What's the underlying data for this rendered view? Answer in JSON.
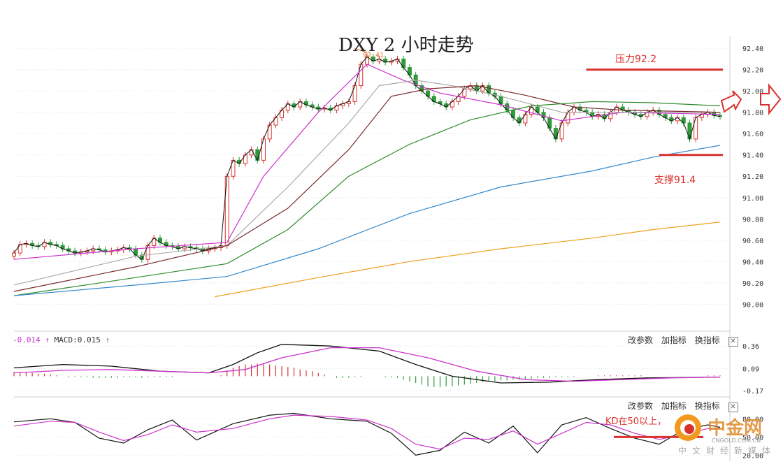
{
  "title": "DXY 2 小时走势",
  "colors": {
    "up": "#d9322e",
    "down": "#2e9a3a",
    "ma_black": "#111111",
    "ma_violet": "#cc33cc",
    "ma_gray": "#aaaaaa",
    "ma_maroon": "#7a2a2a",
    "ma_green": "#2e8b2e",
    "ma_blue": "#3388cc",
    "ma_orange": "#f0a020",
    "annot_red": "#d9322e",
    "grid": "#e6e6e6"
  },
  "toolbar": {
    "params": "改参数",
    "add": "加指标",
    "switch": "换指标",
    "close": "✕"
  },
  "macd_label": {
    "value": "-0.014",
    "arrow": "↑",
    "text": "MACD:0.015",
    "arrow2": "↑"
  },
  "annotations": {
    "resistance": "压力92.2",
    "support": "支撑91.4",
    "kd_note": "KD在50以上，",
    "high_label": "92.41"
  },
  "watermark": {
    "brand": "中金网",
    "domain": "CNGOLD.COM.CN",
    "tagline": "中文财经新媒体",
    "icon": "flame-logo-icon"
  },
  "chart_data": [
    {
      "type": "candlestick",
      "title": "DXY 2 小时走势",
      "y_ticks": [
        "92.40",
        "92.20",
        "92.00",
        "91.80",
        "91.60",
        "91.40",
        "91.20",
        "91.00",
        "90.80",
        "90.60",
        "90.40",
        "90.20",
        "90.00"
      ],
      "ylim": [
        89.93,
        92.46
      ],
      "closes": [
        90.48,
        90.56,
        90.57,
        90.55,
        90.54,
        90.58,
        90.56,
        90.55,
        90.52,
        90.5,
        90.48,
        90.49,
        90.5,
        90.52,
        90.51,
        90.49,
        90.5,
        90.51,
        90.53,
        90.52,
        90.46,
        90.42,
        90.55,
        90.62,
        90.58,
        90.55,
        90.54,
        90.52,
        90.54,
        90.53,
        90.52,
        90.5,
        90.52,
        90.53,
        90.55,
        91.2,
        91.35,
        91.32,
        91.4,
        91.45,
        91.35,
        91.55,
        91.68,
        91.75,
        91.82,
        91.88,
        91.85,
        91.9,
        91.87,
        91.85,
        91.83,
        91.84,
        91.82,
        91.86,
        91.88,
        91.9,
        92.05,
        92.25,
        92.32,
        92.28,
        92.3,
        92.27,
        92.28,
        92.3,
        92.22,
        92.15,
        92.05,
        92.0,
        91.95,
        91.9,
        91.88,
        91.85,
        91.9,
        91.95,
        92.02,
        92.05,
        92.0,
        92.05,
        91.98,
        91.95,
        91.88,
        91.82,
        91.75,
        91.7,
        91.78,
        91.85,
        91.8,
        91.75,
        91.65,
        91.55,
        91.7,
        91.8,
        91.85,
        91.82,
        91.8,
        91.76,
        91.78,
        91.74,
        91.8,
        91.85,
        91.82,
        91.8,
        91.78,
        91.76,
        91.8,
        91.82,
        91.78,
        91.75,
        91.72,
        91.75,
        91.7,
        91.55,
        91.75,
        91.78,
        91.8,
        91.77,
        91.76
      ],
      "ma_lines": [
        {
          "color_key": "ma_violet",
          "x": [
            0,
            20,
            35,
            41,
            50,
            58,
            64,
            70,
            80,
            90,
            100,
            116
          ],
          "y": [
            90.42,
            90.52,
            90.58,
            91.2,
            91.8,
            92.25,
            92.1,
            91.98,
            91.87,
            91.72,
            91.8,
            91.78
          ]
        },
        {
          "color_key": "ma_gray",
          "x": [
            0,
            20,
            35,
            45,
            55,
            60,
            66,
            72,
            80,
            90,
            100,
            116
          ],
          "y": [
            90.18,
            90.45,
            90.55,
            91.1,
            91.7,
            92.05,
            92.1,
            92.05,
            91.95,
            91.8,
            91.8,
            91.8
          ]
        },
        {
          "color_key": "ma_maroon",
          "x": [
            0,
            20,
            35,
            45,
            55,
            62,
            68,
            76,
            84,
            92,
            100,
            116
          ],
          "y": [
            90.12,
            90.35,
            90.55,
            90.9,
            91.45,
            91.95,
            92.02,
            92.05,
            91.96,
            91.85,
            91.82,
            91.8
          ]
        },
        {
          "color_key": "ma_green",
          "x": [
            0,
            20,
            35,
            45,
            55,
            65,
            75,
            85,
            95,
            105,
            116
          ],
          "y": [
            90.08,
            90.25,
            90.38,
            90.7,
            91.2,
            91.5,
            91.73,
            91.86,
            91.9,
            91.89,
            91.86
          ]
        },
        {
          "color_key": "ma_blue",
          "x": [
            0,
            20,
            35,
            50,
            65,
            80,
            95,
            105,
            116
          ],
          "y": [
            90.08,
            90.18,
            90.26,
            90.52,
            90.85,
            91.1,
            91.25,
            91.38,
            91.49
          ]
        },
        {
          "color_key": "ma_orange",
          "x": [
            33,
            50,
            65,
            80,
            95,
            105,
            116
          ],
          "y": [
            90.07,
            90.25,
            90.4,
            90.52,
            90.62,
            90.7,
            90.77
          ]
        }
      ],
      "levels": [
        {
          "label": "压力92.2",
          "value": 92.2,
          "x_from": 94,
          "x_to": 116
        },
        {
          "label": "支撑91.4",
          "value": 91.4,
          "x_from": 106,
          "x_to": 116
        }
      ]
    },
    {
      "type": "macd",
      "y_ticks": [
        "0.36",
        "0.09",
        "-0.17"
      ],
      "ylim": [
        -0.23,
        0.42
      ],
      "hist": [
        0.05,
        0.05,
        0.04,
        0.04,
        0.03,
        0.03,
        0.02,
        0.01,
        0.0,
        -0.01,
        -0.01,
        -0.01,
        -0.01,
        -0.02,
        -0.02,
        -0.02,
        -0.02,
        -0.02,
        -0.01,
        -0.01,
        -0.01,
        -0.02,
        -0.01,
        -0.01,
        -0.01,
        -0.01,
        -0.01,
        0.0,
        0.0,
        0.0,
        0.0,
        0.0,
        0.0,
        0.0,
        0.01,
        0.07,
        0.1,
        0.12,
        0.14,
        0.14,
        0.15,
        0.15,
        0.14,
        0.13,
        0.12,
        0.11,
        0.1,
        0.08,
        0.07,
        0.06,
        0.04,
        0.02,
        0.0,
        -0.02,
        -0.02,
        -0.02,
        -0.01,
        -0.01,
        0.0,
        0.0,
        0.0,
        -0.01,
        -0.01,
        -0.02,
        -0.04,
        -0.06,
        -0.08,
        -0.1,
        -0.12,
        -0.13,
        -0.13,
        -0.12,
        -0.12,
        -0.11,
        -0.1,
        -0.09,
        -0.08,
        -0.07,
        -0.06,
        -0.06,
        -0.05,
        -0.05,
        -0.04,
        -0.04,
        -0.03,
        -0.03,
        -0.02,
        -0.02,
        -0.02,
        -0.01,
        -0.01,
        -0.01,
        -0.01,
        0.0,
        0.0,
        0.0,
        0.01,
        0.01,
        0.01,
        0.01,
        0.01,
        0.01,
        0.01,
        0.01,
        0.0,
        0.0,
        0.0,
        0.0,
        0.0,
        0.0,
        0.0,
        0.0,
        0.0,
        0.0,
        0.01,
        0.01,
        0.01
      ],
      "lines": [
        {
          "color_key": "ma_black",
          "x": [
            0,
            8,
            16,
            24,
            32,
            36,
            40,
            44,
            52,
            60,
            66,
            72,
            80,
            88,
            96,
            104,
            116
          ],
          "y": [
            0.1,
            0.14,
            0.12,
            0.06,
            0.04,
            0.14,
            0.28,
            0.38,
            0.36,
            0.3,
            0.14,
            0.0,
            -0.08,
            -0.07,
            -0.04,
            -0.02,
            -0.01
          ]
        },
        {
          "color_key": "ma_violet",
          "x": [
            0,
            8,
            16,
            24,
            32,
            38,
            44,
            52,
            60,
            68,
            76,
            84,
            92,
            100,
            108,
            116
          ],
          "y": [
            0.04,
            0.07,
            0.08,
            0.06,
            0.04,
            0.08,
            0.22,
            0.34,
            0.34,
            0.22,
            0.06,
            -0.04,
            -0.06,
            -0.04,
            -0.02,
            -0.01
          ]
        }
      ]
    },
    {
      "type": "kd",
      "y_ticks": [
        "80.00",
        "50.00",
        "20.00"
      ],
      "ylim": [
        10,
        100
      ],
      "lines": [
        {
          "color_key": "ma_black",
          "x": [
            0,
            6,
            10,
            14,
            18,
            22,
            26,
            30,
            36,
            42,
            46,
            52,
            58,
            62,
            66,
            70,
            74,
            78,
            82,
            86,
            90,
            94,
            98,
            102,
            106,
            110,
            114,
            116
          ],
          "y": [
            75,
            80,
            74,
            48,
            40,
            62,
            78,
            45,
            72,
            86,
            89,
            80,
            76,
            56,
            20,
            28,
            58,
            40,
            68,
            24,
            70,
            82,
            64,
            48,
            38,
            62,
            70,
            66
          ]
        },
        {
          "color_key": "ma_violet",
          "x": [
            0,
            6,
            10,
            14,
            18,
            22,
            26,
            30,
            36,
            42,
            46,
            52,
            58,
            62,
            66,
            70,
            74,
            78,
            82,
            86,
            90,
            94,
            98,
            102,
            106,
            110,
            114,
            116
          ],
          "y": [
            68,
            76,
            74,
            58,
            44,
            54,
            70,
            58,
            64,
            80,
            86,
            84,
            78,
            64,
            38,
            30,
            48,
            46,
            60,
            38,
            56,
            74,
            70,
            56,
            46,
            54,
            64,
            64
          ]
        }
      ]
    }
  ]
}
